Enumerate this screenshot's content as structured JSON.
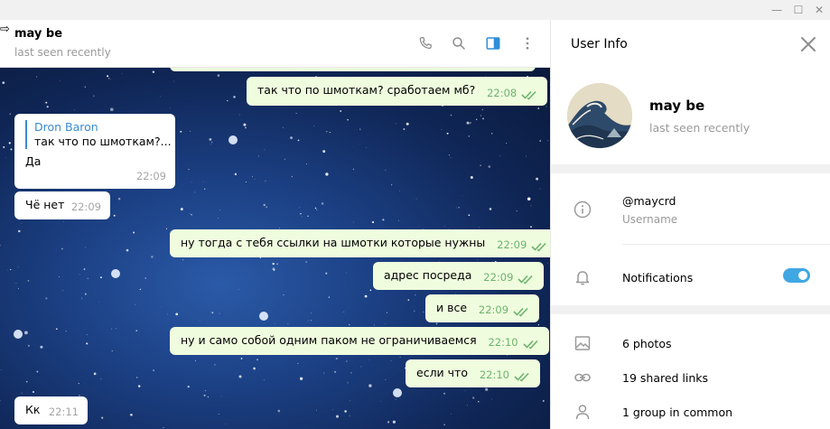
{
  "window": {
    "controls": {
      "minimize": "—",
      "maximize": "☐",
      "close": "✕"
    }
  },
  "chat_header": {
    "cursor_glyph": "⇨",
    "peer_name": "may be",
    "peer_status": "last seen recently",
    "icons": [
      "phone-icon",
      "search-icon",
      "sidebar-toggle-icon",
      "more-icon"
    ]
  },
  "messages": [
    {
      "direction": "out",
      "text": "так что по шмоткам? сработаем мб?",
      "time": "22:08",
      "read": true
    },
    {
      "direction": "in",
      "reply_name": "Dron Baron",
      "reply_text": "так что по шмоткам?...",
      "text": "Да",
      "time": "22:09"
    },
    {
      "direction": "in",
      "text": "Чё нет",
      "time": "22:09"
    },
    {
      "direction": "out",
      "text": "ну тогда с тебя ссылки на шмотки которые нужны",
      "time": "22:09",
      "read": true
    },
    {
      "direction": "out",
      "text": "адрес посреда",
      "time": "22:09",
      "read": true
    },
    {
      "direction": "out",
      "text": "и все",
      "time": "22:09",
      "read": true
    },
    {
      "direction": "out",
      "text": "ну и само собой одним паком не ограничиваемся",
      "time": "22:10",
      "read": true
    },
    {
      "direction": "out",
      "text": "если что",
      "time": "22:10",
      "read": true
    },
    {
      "direction": "in",
      "text": "Кк",
      "time": "22:11"
    }
  ],
  "user_info": {
    "title": "User Info",
    "name": "may be",
    "status": "last seen recently",
    "username": "@maycrd",
    "username_label": "Username",
    "notifications_label": "Notifications",
    "notifications_on": true,
    "photos": "6 photos",
    "shared_links": "19 shared links",
    "groups_in_common": "1 group in common"
  },
  "colors": {
    "accent": "#40a7e3",
    "outgoing_bubble": "#effdde",
    "read_check": "#6cb36e"
  }
}
